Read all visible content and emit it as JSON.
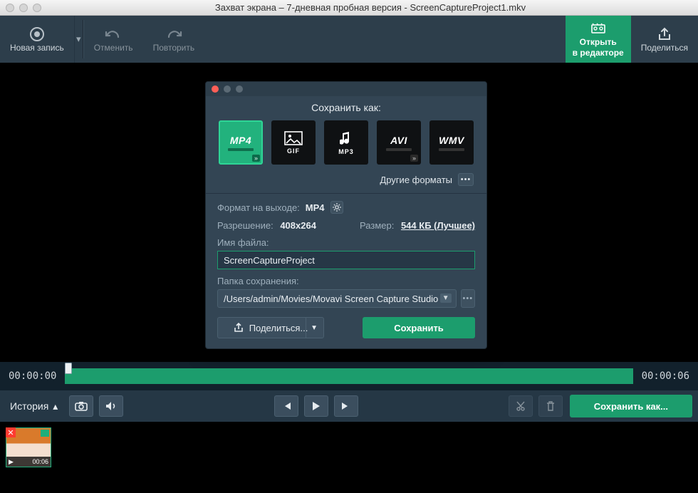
{
  "titlebar": {
    "title": "Захват экрана – 7-дневная пробная версия - ScreenCaptureProject1.mkv"
  },
  "toolbar": {
    "new_record": "Новая запись",
    "undo": "Отменить",
    "redo": "Повторить",
    "open_editor_l1": "Открыть",
    "open_editor_l2": "в редакторе",
    "share": "Поделиться"
  },
  "dialog": {
    "title": "Сохранить как:",
    "formats": {
      "mp4": "MP4",
      "gif": "GIF",
      "mp3": "MP3",
      "avi": "AVI",
      "wmv": "WMV"
    },
    "other_formats": "Другие форматы",
    "out_format_label": "Формат на выходе:",
    "out_format_value": "MP4",
    "resolution_label": "Разрешение:",
    "resolution_value": "408x264",
    "size_label": "Размер:",
    "size_value": "544 КБ (Лучшее)",
    "filename_label": "Имя файла:",
    "filename_value": "ScreenCaptureProject",
    "folder_label": "Папка сохранения:",
    "folder_value": "/Users/admin/Movies/Movavi Screen Capture Studio",
    "share_btn": "Поделиться...",
    "save_btn": "Сохранить"
  },
  "timeline": {
    "start": "00:00:00",
    "end": "00:00:06"
  },
  "controls": {
    "history": "История",
    "save_as": "Сохранить как..."
  },
  "thumb": {
    "duration": "00:06"
  }
}
